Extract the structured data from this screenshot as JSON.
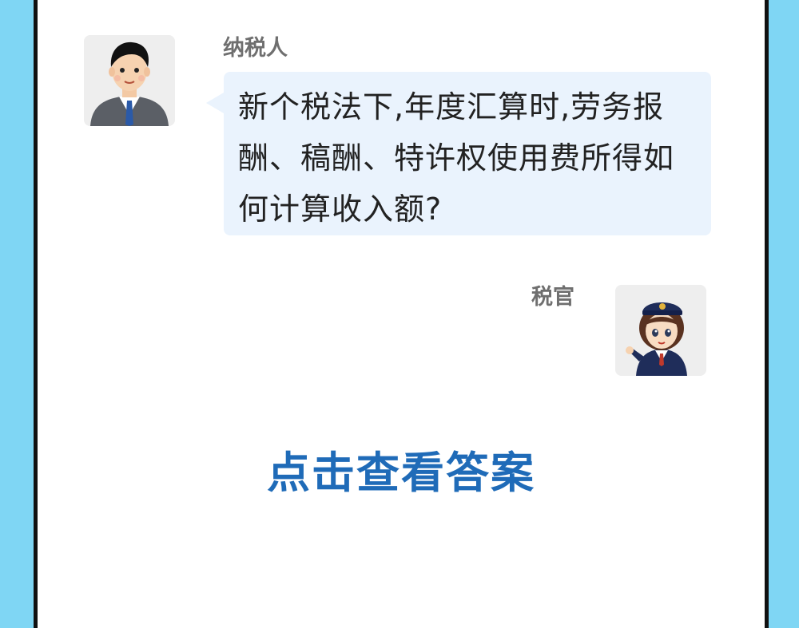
{
  "colors": {
    "background": "#7fd6f4",
    "panel": "#ffffff",
    "bubble": "#eaf3fd",
    "button_text": "#1f6bb8",
    "name_text": "#6f6f6f"
  },
  "conversation": {
    "taxpayer": {
      "name": "纳税人",
      "avatar_icon": "man-in-suit-avatar-icon",
      "message": "新个税法下,年度汇算时,劳务报酬、稿酬、特许权使用费所得如何计算收入额?"
    },
    "officer": {
      "name": "税官",
      "avatar_icon": "tax-officer-woman-avatar-icon"
    }
  },
  "answer_button": {
    "label": "点击查看答案"
  }
}
